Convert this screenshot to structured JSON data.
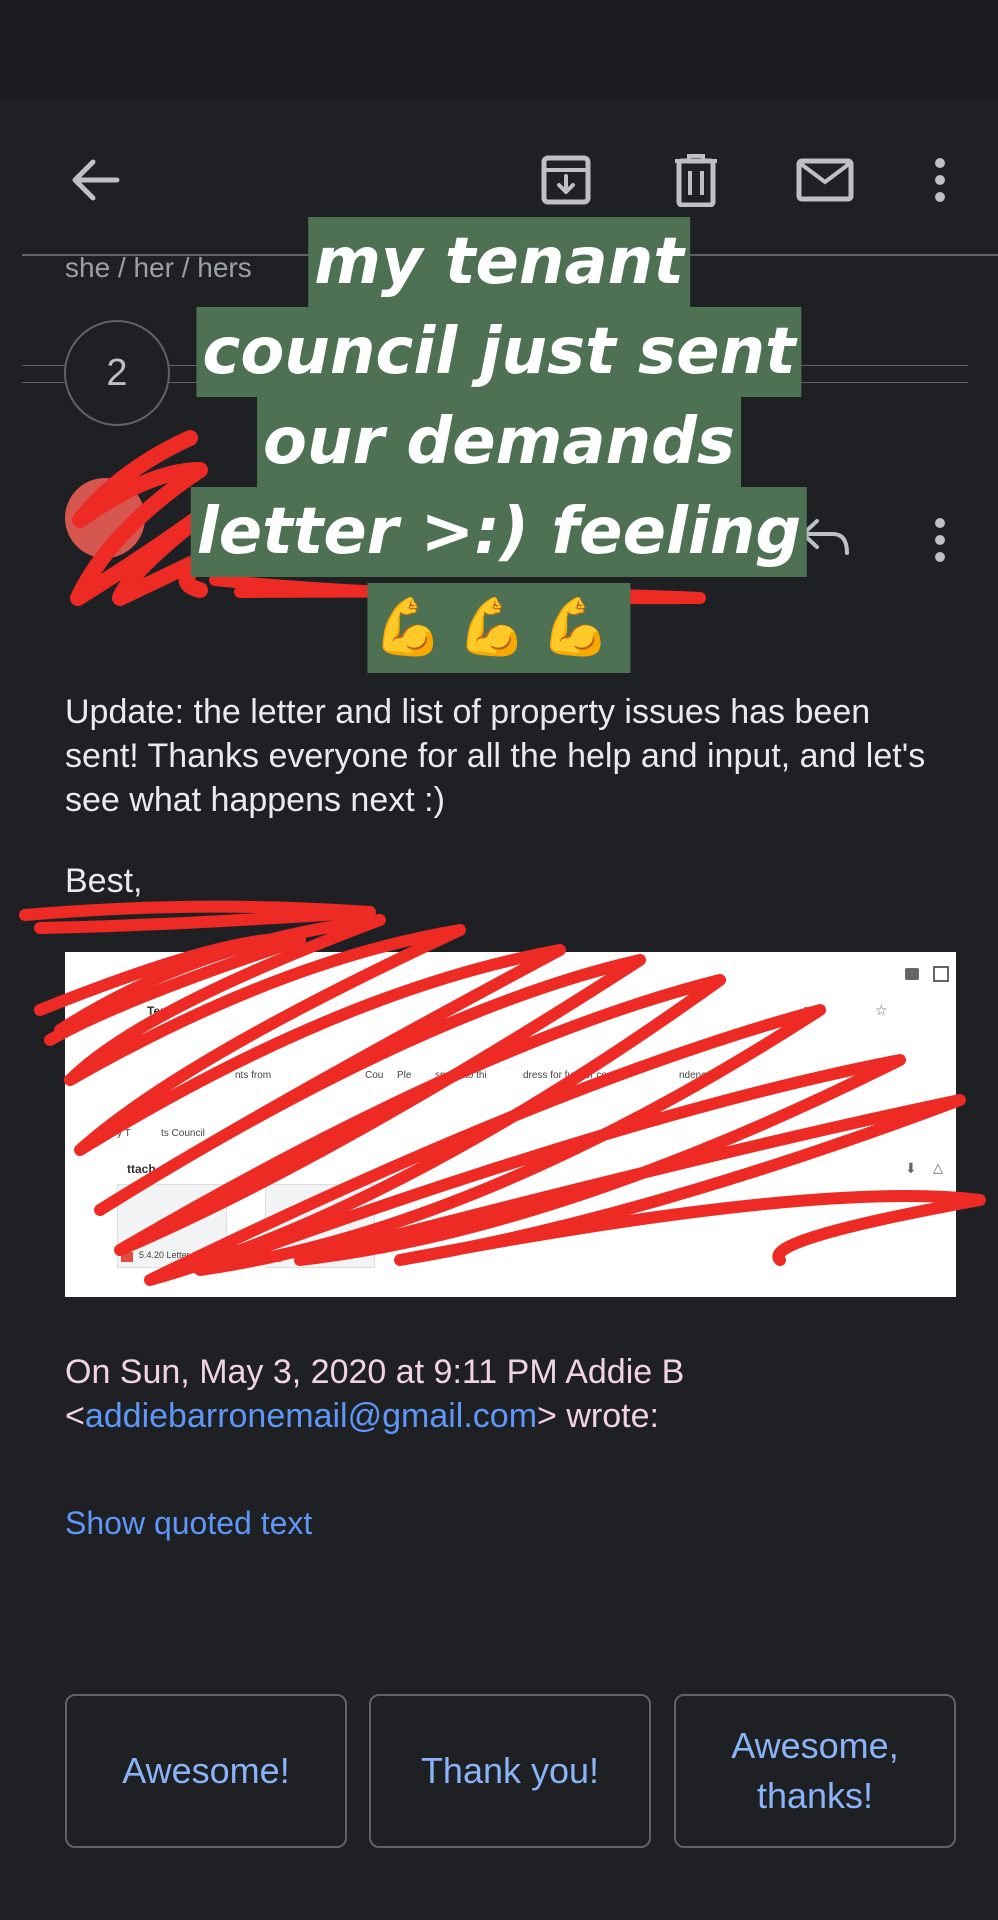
{
  "toolbar": {
    "back_icon": "arrow-left-icon",
    "archive_icon": "archive-icon",
    "delete_icon": "trash-icon",
    "mark_unread_icon": "mail-icon",
    "more_icon": "more-vert-icon"
  },
  "thread": {
    "pronouns": "she / her / hers",
    "collapsed_count": "2"
  },
  "overlay": {
    "lines": [
      "my tenant",
      "council just sent",
      "our demands",
      "letter >:) feeling",
      "💪💪💪"
    ],
    "background_color": "#4d7152"
  },
  "message": {
    "reply_icon": "reply-icon",
    "more_icon": "more-vert-icon",
    "body": "Update: the letter and list of property issues has been sent! Thanks everyone for all the help and input, and let's see what happens next :)",
    "sign_off": "Best,",
    "attachment_image": {
      "visible_fragments": [
        "Tena",
        "ago)",
        "nts from",
        "Cou",
        "Ple",
        "spond to thi",
        "dress for further cor",
        "ndence",
        "y T",
        "ts Council",
        "ttach",
        "5.4.20 Letter to Ms...",
        "Ou"
      ]
    },
    "quote_header_prefix": "On Sun, May 3, 2020 at 9:11 PM Addie B <",
    "quote_email": "addiebarronemail@gmail.com",
    "quote_header_suffix": "> wrote:",
    "show_quoted_text": "Show quoted text"
  },
  "smart_replies": [
    "Awesome!",
    "Thank you!",
    "Awesome, thanks!"
  ],
  "colors": {
    "background": "#1f2024",
    "link": "#5e97f6",
    "smart_reply_text": "#8ab4f8",
    "scribble": "#ee2a24"
  }
}
